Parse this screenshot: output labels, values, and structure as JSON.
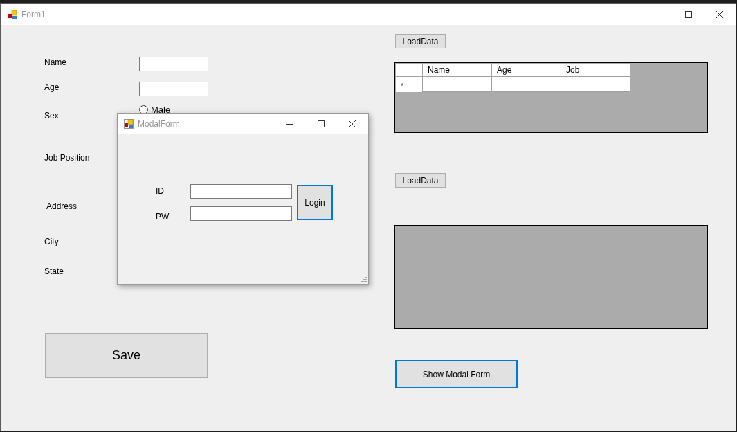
{
  "window": {
    "title": "Form1"
  },
  "labels": [
    {
      "text": "Name",
      "kind": "label"
    },
    {
      "text": "Age",
      "kind": "label"
    },
    {
      "text": "Sex",
      "kind": "label"
    },
    {
      "text": "Job Position",
      "kind": "label"
    },
    {
      "text": "Address",
      "kind": "label"
    },
    {
      "text": "City",
      "kind": "label"
    },
    {
      "text": "State",
      "kind": "label"
    }
  ],
  "fields": [
    {
      "kind": "text"
    },
    {
      "kind": "text"
    }
  ],
  "radios": [
    {
      "label": "Male",
      "selected": false
    }
  ],
  "save_button": "Save",
  "grids": [
    {
      "button": "LoadData",
      "columns": [
        "Name",
        "Age",
        "Job"
      ],
      "new_row_marker": "*"
    },
    {
      "button": "LoadData"
    }
  ],
  "show_modal_button": {
    "label": "Show Modal Form",
    "focused": true
  },
  "modal": {
    "title": "ModalForm",
    "fields": [
      {
        "label": "ID"
      },
      {
        "label": "PW"
      }
    ],
    "login_button": {
      "label": "Login",
      "focused": true
    }
  }
}
